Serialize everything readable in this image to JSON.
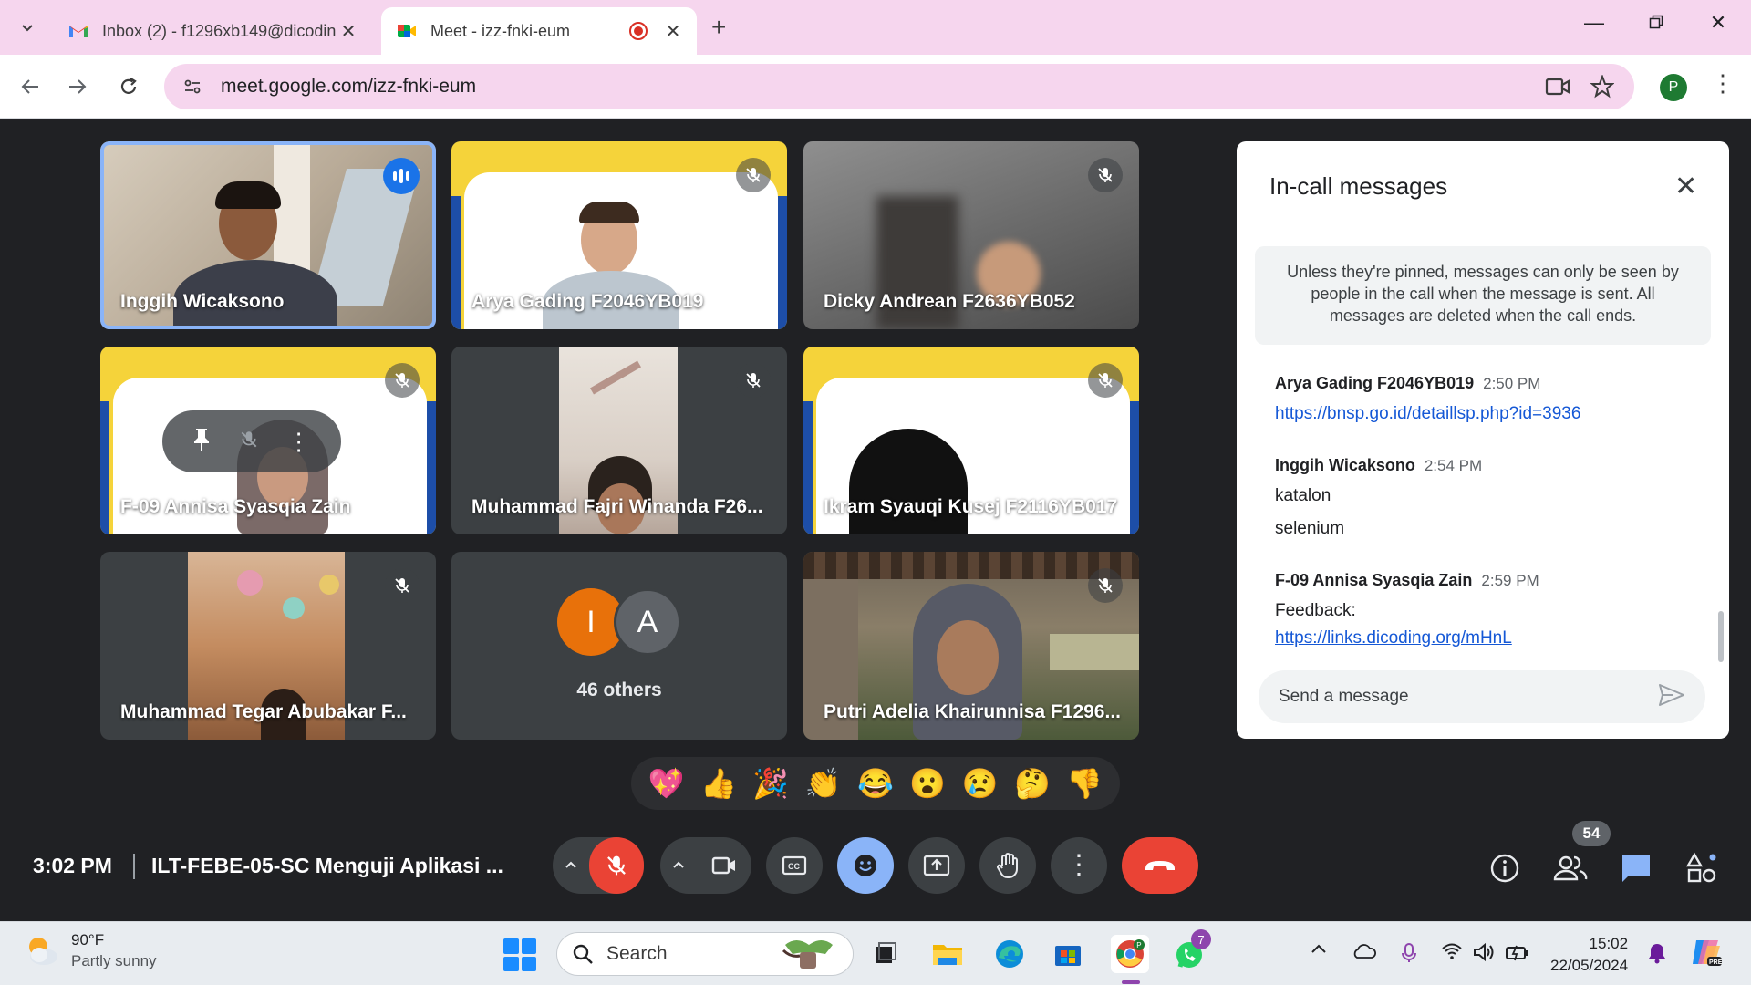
{
  "browser": {
    "tabs": [
      {
        "title": "Inbox (2) - f1296xb149@dicodin",
        "icon": "gmail-icon"
      },
      {
        "title": "Meet - izz-fnki-eum",
        "icon": "meet-icon",
        "recording": true
      }
    ],
    "url": "meet.google.com/izz-fnki-eum",
    "profile_initial": "P"
  },
  "meet": {
    "tiles": [
      {
        "name": "Inggih Wicaksono",
        "speaking": true
      },
      {
        "name": "Arya Gading F2046YB019",
        "muted": true
      },
      {
        "name": "Dicky Andrean F2636YB052",
        "muted": true
      },
      {
        "name": "F-09 Annisa Syasqia Zain",
        "muted": true
      },
      {
        "name": "Muhammad Fajri Winanda F26...",
        "muted": true
      },
      {
        "name": "Ikram Syauqi Kusej F2116YB017",
        "muted": true
      },
      {
        "name": "Muhammad Tegar Abubakar F...",
        "muted": true
      },
      {
        "others_label": "46 others",
        "avatars": [
          "I",
          "A"
        ],
        "avatar_colors": [
          "#e8710a",
          "#5f6368"
        ]
      },
      {
        "name": "Putri Adelia Khairunnisa F1296...",
        "muted": true
      }
    ],
    "chat": {
      "title": "In-call messages",
      "note": "Unless they're pinned, messages can only be seen by people in the call when the message is sent. All messages are deleted when the call ends.",
      "messages": [
        {
          "sender": "Arya Gading F2046YB019",
          "time": "2:50 PM",
          "lines": [],
          "link": "https://bnsp.go.id/detaillsp.php?id=3936"
        },
        {
          "sender": "Inggih Wicaksono",
          "time": "2:54 PM",
          "lines": [
            "katalon",
            "selenium"
          ]
        },
        {
          "sender": "F-09 Annisa Syasqia Zain",
          "time": "2:59 PM",
          "lines": [
            "Feedback:"
          ],
          "link": "https://links.dicoding.org/mHnL"
        }
      ],
      "input_placeholder": "Send a message"
    },
    "reactions": [
      "💖",
      "👍",
      "🎉",
      "👏",
      "😂",
      "😮",
      "😢",
      "🤔",
      "👎"
    ],
    "bottom": {
      "time": "3:02 PM",
      "meeting_name": "ILT-FEBE-05-SC Menguji Aplikasi ...",
      "people_count": "54"
    }
  },
  "taskbar": {
    "weather_temp": "90°F",
    "weather_desc": "Partly sunny",
    "search_placeholder": "Search",
    "time": "15:02",
    "date": "22/05/2024",
    "whatsapp_badge": "7"
  }
}
